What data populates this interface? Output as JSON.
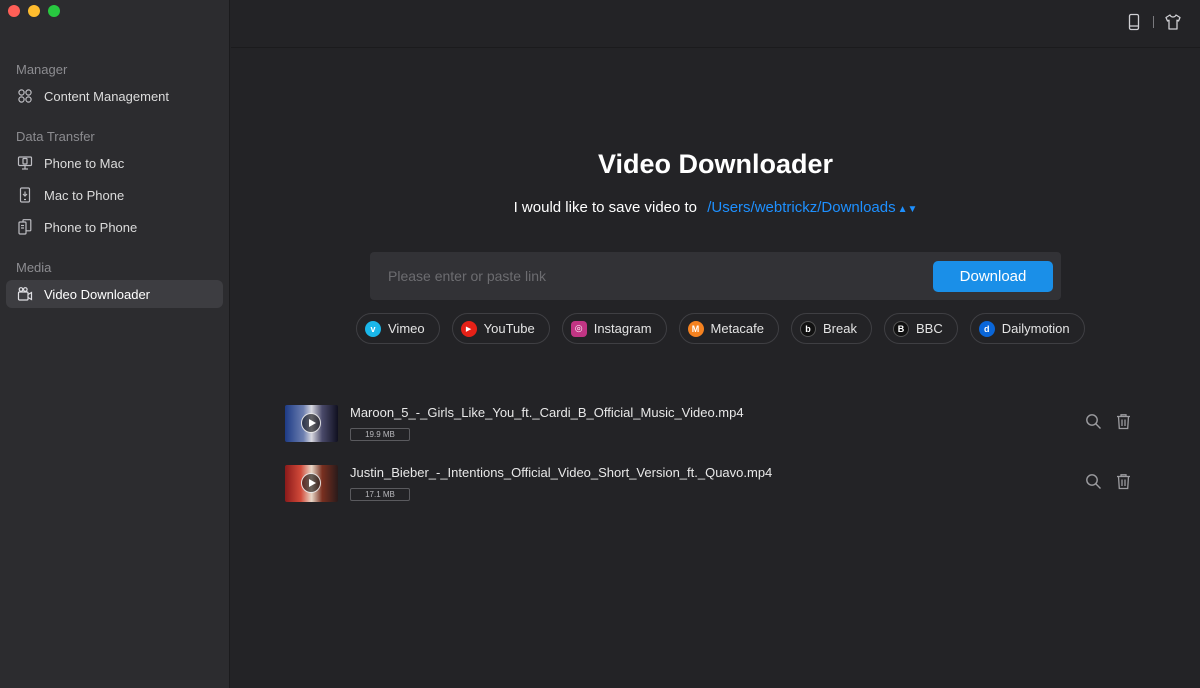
{
  "sidebar": {
    "sections": [
      {
        "title": "Manager"
      },
      {
        "title": "Data Transfer"
      },
      {
        "title": "Media"
      }
    ],
    "items": [
      {
        "label": "Content Management",
        "icon": "grid-icon"
      },
      {
        "label": "Phone to Mac",
        "icon": "phone-to-mac-icon"
      },
      {
        "label": "Mac to Phone",
        "icon": "mac-to-phone-icon"
      },
      {
        "label": "Phone to Phone",
        "icon": "phone-to-phone-icon"
      },
      {
        "label": "Video Downloader",
        "icon": "video-camera-icon",
        "active": true
      }
    ]
  },
  "topbar": {
    "icons": [
      "device-icon",
      "tshirt-icon"
    ]
  },
  "main": {
    "title": "Video Downloader",
    "save_prefix": "I would like to save video to",
    "save_path": "/Users/webtrickz/Downloads",
    "link_placeholder": "Please enter or paste link",
    "download_label": "Download",
    "accent": "#1a8fe8",
    "sites": [
      {
        "label": "Vimeo",
        "color": "#1ab7ea",
        "glyph": "v"
      },
      {
        "label": "YouTube",
        "color": "#e62117",
        "glyph": "▶"
      },
      {
        "label": "Instagram",
        "color": "#c13584",
        "glyph": "◎"
      },
      {
        "label": "Metacafe",
        "color": "#f58220",
        "glyph": "M"
      },
      {
        "label": "Break",
        "color": "#111111",
        "glyph": "b"
      },
      {
        "label": "BBC",
        "color": "#111111",
        "glyph": "B"
      },
      {
        "label": "Dailymotion",
        "color": "#0a66d8",
        "glyph": "d"
      }
    ]
  },
  "videos": [
    {
      "name": "Maroon_5_-_Girls_Like_You_ft._Cardi_B_Official_Music_Video.mp4",
      "size": "19.9 MB"
    },
    {
      "name": "Justin_Bieber_-_Intentions_Official_Video_Short_Version_ft._Quavo.mp4",
      "size": "17.1 MB"
    }
  ]
}
